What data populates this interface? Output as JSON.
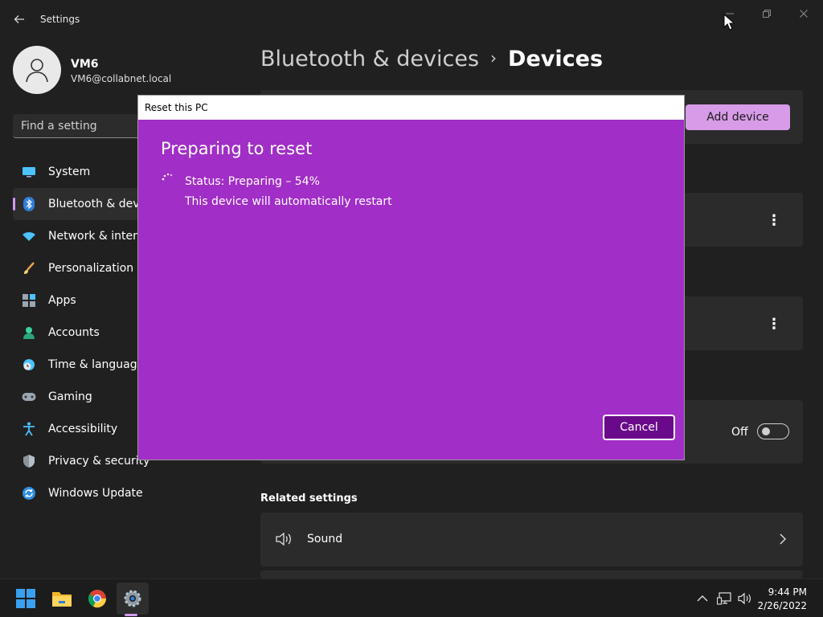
{
  "window": {
    "app_title": "Settings",
    "back_icon": "back-arrow-icon",
    "controls": [
      "minimize-icon",
      "restore-icon",
      "close-icon"
    ]
  },
  "profile": {
    "name": "VM6",
    "email": "VM6@collabnet.local",
    "avatar_icon": "user-avatar-icon"
  },
  "search": {
    "placeholder": "Find a setting"
  },
  "sidebar": {
    "items": [
      {
        "label": "System",
        "icon": "system-display-icon",
        "active": false
      },
      {
        "label": "Bluetooth & devices",
        "icon": "bluetooth-icon",
        "active": true
      },
      {
        "label": "Network & internet",
        "icon": "wifi-icon",
        "active": false
      },
      {
        "label": "Personalization",
        "icon": "paintbrush-icon",
        "active": false
      },
      {
        "label": "Apps",
        "icon": "apps-icon",
        "active": false
      },
      {
        "label": "Accounts",
        "icon": "accounts-icon",
        "active": false
      },
      {
        "label": "Time & language",
        "icon": "clock-globe-icon",
        "active": false
      },
      {
        "label": "Gaming",
        "icon": "gamepad-icon",
        "active": false
      },
      {
        "label": "Accessibility",
        "icon": "accessibility-icon",
        "active": false
      },
      {
        "label": "Privacy & security",
        "icon": "shield-icon",
        "active": false
      },
      {
        "label": "Windows Update",
        "icon": "update-icon",
        "active": false
      }
    ]
  },
  "header": {
    "breadcrumb_parent": "Bluetooth & devices",
    "breadcrumb_separator": "›",
    "breadcrumb_current": "Devices"
  },
  "main": {
    "add_device_label": "Add device",
    "toggle_label": "Off",
    "toggle_state": false,
    "related_settings_title": "Related settings",
    "sound_label": "Sound"
  },
  "dialog": {
    "window_title": "Reset this PC",
    "heading": "Preparing to reset",
    "status": "Status: Preparing – 54%",
    "progress_percent": 54,
    "note": "This device will automatically restart",
    "cancel_label": "Cancel",
    "background_color": "#a12ec6"
  },
  "taskbar": {
    "apps": [
      "windows-start-icon",
      "file-explorer-icon",
      "chrome-icon",
      "settings-gear-icon"
    ],
    "tray": [
      "chevron-up-icon",
      "network-icon",
      "volume-icon"
    ],
    "time": "9:44 PM",
    "date": "2/26/2022"
  },
  "colors": {
    "accent": "#d29bf0",
    "background": "#202020",
    "card": "#2b2b2b"
  }
}
